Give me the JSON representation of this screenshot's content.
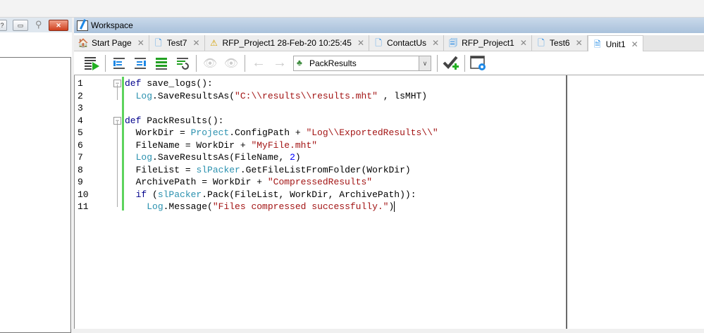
{
  "window": {
    "workspace_title": "Workspace"
  },
  "tabs": [
    {
      "label": "Start Page",
      "icon": "home-icon"
    },
    {
      "label": "Test7",
      "icon": "keyword-test-icon"
    },
    {
      "label": "RFP_Project1 28-Feb-20 10:25:45",
      "icon": "log-warning-icon"
    },
    {
      "label": "ContactUs",
      "icon": "keyword-test-icon"
    },
    {
      "label": "RFP_Project1",
      "icon": "project-icon"
    },
    {
      "label": "Test6",
      "icon": "keyword-test-icon"
    },
    {
      "label": "Unit1",
      "icon": "script-unit-icon",
      "active": true
    }
  ],
  "toolbar": {
    "routine_selector": "PackResults"
  },
  "editor": {
    "lines": [
      {
        "n": "1",
        "indent": 0,
        "fold": true,
        "tokens": [
          [
            "kw",
            "def"
          ],
          [
            "pl",
            " save_logs():"
          ]
        ]
      },
      {
        "n": "2",
        "indent": 2,
        "tokens": [
          [
            "obj",
            "Log"
          ],
          [
            "pl",
            ".SaveResultsAs("
          ],
          [
            "str",
            "\"C:\\\\results\\\\results.mht\""
          ],
          [
            "pl",
            " , lsMHT)"
          ]
        ]
      },
      {
        "n": "3",
        "indent": 0,
        "tokens": []
      },
      {
        "n": "4",
        "indent": 0,
        "fold": true,
        "tokens": [
          [
            "kw",
            "def"
          ],
          [
            "pl",
            " PackResults():"
          ]
        ]
      },
      {
        "n": "5",
        "indent": 2,
        "tokens": [
          [
            "pl",
            "WorkDir = "
          ],
          [
            "obj",
            "Project"
          ],
          [
            "pl",
            ".ConfigPath + "
          ],
          [
            "str",
            "\"Log\\\\ExportedResults\\\\\""
          ]
        ]
      },
      {
        "n": "6",
        "indent": 2,
        "tokens": [
          [
            "pl",
            "FileName = WorkDir + "
          ],
          [
            "str",
            "\"MyFile.mht\""
          ]
        ]
      },
      {
        "n": "7",
        "indent": 2,
        "tokens": [
          [
            "obj",
            "Log"
          ],
          [
            "pl",
            ".SaveResultsAs(FileName, "
          ],
          [
            "num",
            "2"
          ],
          [
            "pl",
            ")"
          ]
        ]
      },
      {
        "n": "8",
        "indent": 2,
        "tokens": [
          [
            "pl",
            "FileList = "
          ],
          [
            "obj",
            "slPacker"
          ],
          [
            "pl",
            ".GetFileListFromFolder(WorkDir)"
          ]
        ]
      },
      {
        "n": "9",
        "indent": 2,
        "tokens": [
          [
            "pl",
            "ArchivePath = WorkDir + "
          ],
          [
            "str",
            "\"CompressedResults\""
          ]
        ]
      },
      {
        "n": "10",
        "indent": 2,
        "tokens": [
          [
            "kw",
            "if"
          ],
          [
            "pl",
            " ("
          ],
          [
            "obj",
            "slPacker"
          ],
          [
            "pl",
            ".Pack(FileList, WorkDir, ArchivePath)):"
          ]
        ]
      },
      {
        "n": "11",
        "indent": 4,
        "tokens": [
          [
            "obj",
            "Log"
          ],
          [
            "pl",
            ".Message("
          ],
          [
            "str",
            "\"Files compressed successfully.\""
          ],
          [
            "pl",
            ")"
          ]
        ],
        "caret": true
      }
    ]
  }
}
